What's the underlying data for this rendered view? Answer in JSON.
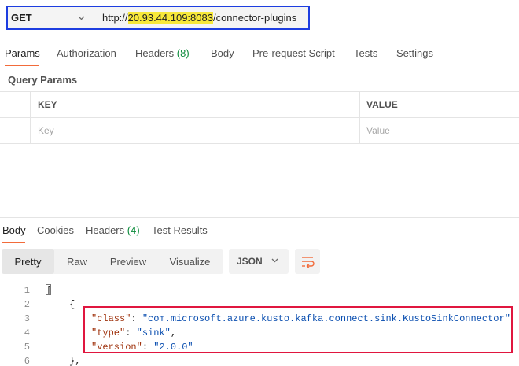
{
  "request": {
    "method": "GET",
    "url_prefix": "http://",
    "url_host": "20.93.44.109:8083",
    "url_path": "/connector-plugins"
  },
  "request_tabs": [
    {
      "label": "Params",
      "active": true
    },
    {
      "label": "Authorization"
    },
    {
      "label": "Headers",
      "count": "(8)"
    },
    {
      "label": "Body"
    },
    {
      "label": "Pre-request Script"
    },
    {
      "label": "Tests"
    },
    {
      "label": "Settings"
    }
  ],
  "query_params": {
    "title": "Query Params",
    "headers": {
      "key": "KEY",
      "value": "VALUE"
    },
    "placeholders": {
      "key": "Key",
      "value": "Value"
    }
  },
  "response_tabs": [
    {
      "label": "Body",
      "active": true
    },
    {
      "label": "Cookies"
    },
    {
      "label": "Headers",
      "count": "(4)"
    },
    {
      "label": "Test Results"
    }
  ],
  "view_modes": [
    "Pretty",
    "Raw",
    "Preview",
    "Visualize"
  ],
  "selected_view": "Pretty",
  "format": "JSON",
  "code": {
    "line_numbers": [
      "1",
      "2",
      "3",
      "4",
      "5",
      "6"
    ],
    "open_array": "[",
    "open_object": "{",
    "close_object": "},",
    "lines": [
      {
        "key": "\"class\"",
        "sep": ": ",
        "value": "\"com.microsoft.azure.kusto.kafka.connect.sink.KustoSinkConnector\"",
        "end": ","
      },
      {
        "key": "\"type\"",
        "sep": ": ",
        "value": "\"sink\"",
        "end": ","
      },
      {
        "key": "\"version\"",
        "sep": ": ",
        "value": "\"2.0.0\"",
        "end": ""
      }
    ]
  },
  "colors": {
    "accent": "#f26b3a",
    "count_green": "#0a8a3a",
    "url_highlight": "#f7e83a",
    "request_box": "#1d3de0",
    "code_box": "#e0163f",
    "json_key": "#a0340f",
    "json_string": "#0b4fb0"
  },
  "icons": [
    "chevron-down-icon",
    "wrap-lines-icon"
  ]
}
